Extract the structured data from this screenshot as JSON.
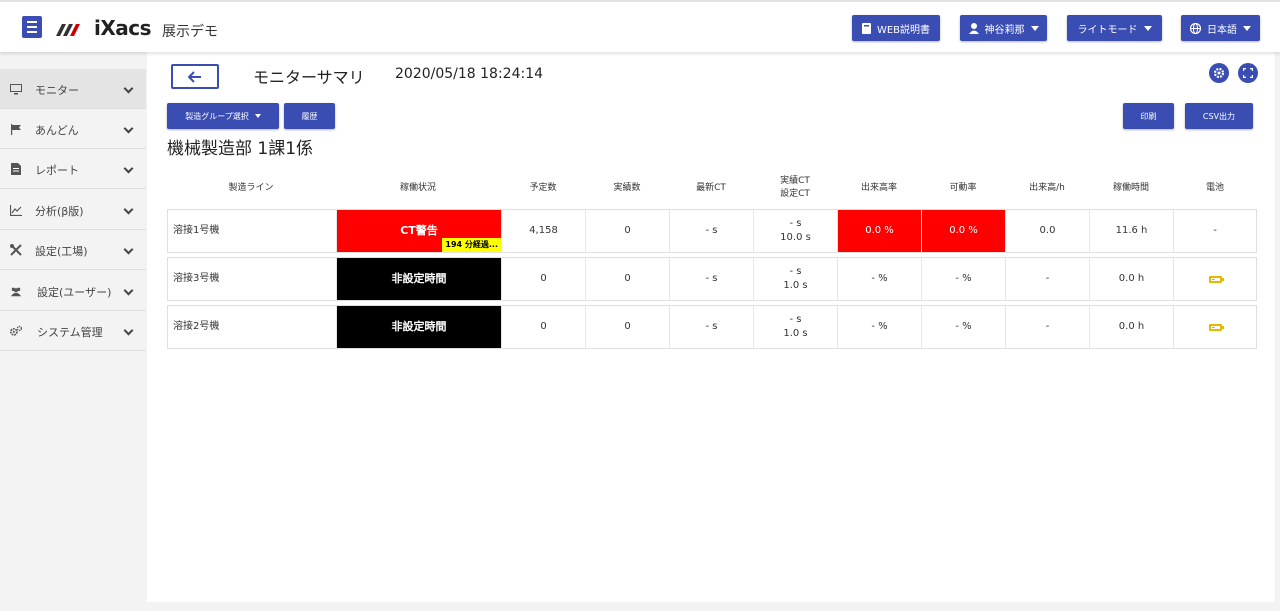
{
  "header": {
    "logo_text": "iXacs",
    "app_title": "展示デモ",
    "manual_label": "WEB説明書",
    "user_label": "神谷莉那",
    "mode_label": "ライトモード",
    "language_label": "日本語"
  },
  "sidebar": {
    "items": [
      {
        "label": "モニター",
        "icon": "monitor-icon"
      },
      {
        "label": "あんどん",
        "icon": "flag-icon"
      },
      {
        "label": "レポート",
        "icon": "document-icon"
      },
      {
        "label": "分析(β版)",
        "icon": "chart-icon"
      },
      {
        "label": "設定(工場)",
        "icon": "tools-icon"
      },
      {
        "label": "設定(ユーザー)",
        "icon": "users-icon"
      },
      {
        "label": "システム管理",
        "icon": "cogs-icon"
      }
    ]
  },
  "main": {
    "title": "モニターサマリ",
    "datetime": "2020/05/18 18:24:14",
    "group_select_label": "製造グループ選択",
    "history_label": "履歴",
    "print_label": "印刷",
    "csv_label": "CSV出力",
    "section_title": "機械製造部 1課1係"
  },
  "table": {
    "headers": [
      "製造ライン",
      "稼働状況",
      "予定数",
      "実績数",
      "最新CT",
      "実績CT",
      "設定CT",
      "出来高率",
      "可動率",
      "出来高/h",
      "稼働時間",
      "電池"
    ],
    "rows": [
      {
        "line": "溶接1号機",
        "status": "CT警告",
        "elapsed": "194 分経過...",
        "planned": "4,158",
        "actual": "0",
        "latest_ct": "- s",
        "actual_ct": "- s",
        "set_ct": "10.0 s",
        "output_rate": "0.0 %",
        "uptime": "0.0 %",
        "per_hour": "0.0",
        "run_time": "11.6 h",
        "battery": "-"
      },
      {
        "line": "溶接3号機",
        "status": "非設定時間",
        "planned": "0",
        "actual": "0",
        "latest_ct": "- s",
        "actual_ct": "- s",
        "set_ct": "1.0 s",
        "output_rate": "- %",
        "uptime": "- %",
        "per_hour": "-",
        "run_time": "0.0 h"
      },
      {
        "line": "溶接2号機",
        "status": "非設定時間",
        "planned": "0",
        "actual": "0",
        "latest_ct": "- s",
        "actual_ct": "- s",
        "set_ct": "1.0 s",
        "output_rate": "- %",
        "uptime": "- %",
        "per_hour": "-",
        "run_time": "0.0 h"
      }
    ]
  },
  "colors": {
    "accent": "#3a4db3",
    "alert_red": "#ff0000",
    "idle_black": "#000000",
    "elapsed_yellow": "#ffff00",
    "battery_yellow": "#e6b800"
  }
}
